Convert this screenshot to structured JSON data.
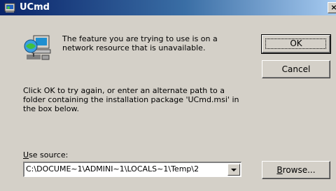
{
  "window": {
    "title": "UCmd",
    "close_glyph": "×"
  },
  "message": {
    "line1": "The feature you are trying to use is on a network resource that is unavailable.",
    "line2": "Click OK to try again, or enter an alternate path to a folder containing the installation package 'UCmd.msi' in the box below."
  },
  "buttons": {
    "ok": "OK",
    "cancel": "Cancel",
    "browse_prefix": "B",
    "browse_rest": "rowse..."
  },
  "source": {
    "label_prefix": "U",
    "label_rest": "se source:",
    "value": "C:\\DOCUME~1\\ADMINI~1\\LOCALS~1\\Temp\\2"
  },
  "icons": {
    "title": "installer-icon",
    "main": "network-computer-icon",
    "dropdown": "chevron-down-icon"
  },
  "colors": {
    "titlebar_start": "#0a246a",
    "titlebar_end": "#a6caf0",
    "face": "#d4d0c8"
  }
}
